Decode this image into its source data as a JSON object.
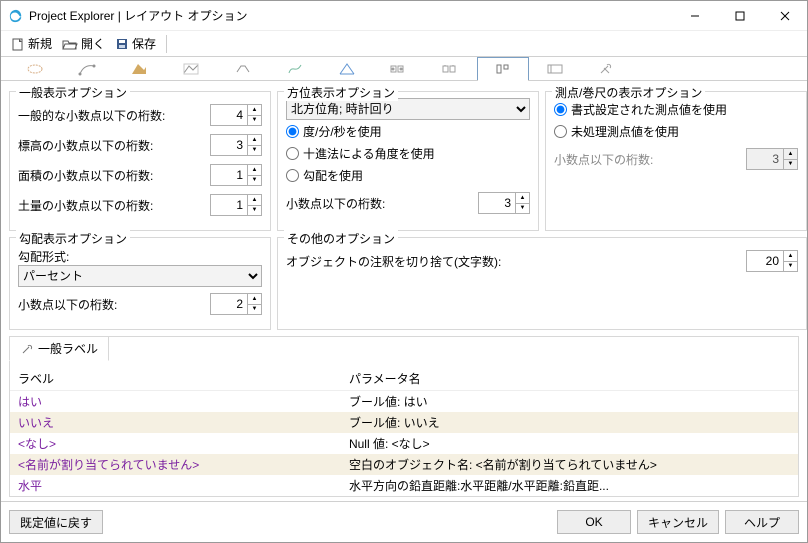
{
  "title": "Project Explorer | レイアウト オプション",
  "toolbar": {
    "new": "新規",
    "open": "開く",
    "save": "保存"
  },
  "tabs": {
    "activeIndex": 9
  },
  "generalDisplay": {
    "legend": "一般表示オプション",
    "rows": {
      "general_decimals_label": "一般的な小数点以下の桁数:",
      "general_decimals_value": "4",
      "elevation_decimals_label": "標高の小数点以下の桁数:",
      "elevation_decimals_value": "3",
      "area_decimals_label": "面積の小数点以下の桁数:",
      "area_decimals_value": "1",
      "volume_decimals_label": "土量の小数点以下の桁数:",
      "volume_decimals_value": "1"
    }
  },
  "gradeDisplay": {
    "legend": "勾配表示オプション",
    "format_label": "勾配形式:",
    "format_value": "パーセント",
    "decimals_label": "小数点以下の桁数:",
    "decimals_value": "2"
  },
  "bearingDisplay": {
    "legend": "方位表示オプション",
    "type_value": "北方位角; 時計回り",
    "opt_dms": "度/分/秒を使用",
    "opt_decimal": "十進法による角度を使用",
    "opt_grade": "勾配を使用",
    "decimals_label": "小数点以下の桁数:",
    "decimals_value": "3"
  },
  "other": {
    "legend": "その他のオプション",
    "truncate_label": "オブジェクトの注釈を切り捨て(文字数):",
    "truncate_value": "20"
  },
  "stationTape": {
    "legend": "測点/巻尺の表示オプション",
    "opt_formatted": "書式設定された測点値を使用",
    "opt_raw": "未処理測点値を使用",
    "decimals_label": "小数点以下の桁数:",
    "decimals_value": "3"
  },
  "generalLabels": {
    "tab": "一般ラベル",
    "header_label": "ラベル",
    "header_param": "パラメータ名",
    "rows": [
      {
        "label": "はい",
        "param": "ブール値: はい"
      },
      {
        "label": "いいえ",
        "param": "ブール値: いいえ"
      },
      {
        "label": "<なし>",
        "param": "Null 値: <なし>"
      },
      {
        "label": "<名前が割り当てられていません>",
        "param": "空白のオブジェクト名: <名前が割り当てられていません>"
      },
      {
        "label": "水平",
        "param": "水平方向の鉛直距離:水平距離/水平距離:鉛直距..."
      }
    ]
  },
  "footer": {
    "reset": "既定値に戻す",
    "ok": "OK",
    "cancel": "キャンセル",
    "help": "ヘルプ"
  }
}
